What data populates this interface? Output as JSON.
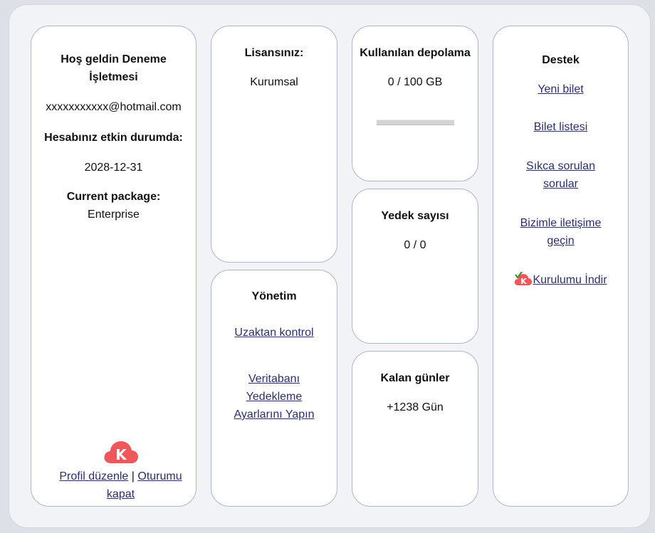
{
  "profile": {
    "welcome": "Hoş geldin Deneme İşletmesi",
    "email": "xxxxxxxxxxx@hotmail.com",
    "active_label": "Hesabınız etkin durumda:",
    "expiry_date": "2028-12-31",
    "package_label": "Current package:",
    "package_value": "Enterprise",
    "edit_profile": "Profil düzenle",
    "separator": "|",
    "logout": "Oturumu kapat",
    "logo_letter": "K"
  },
  "license": {
    "title": "Lisansınız:",
    "value": "Kurumsal"
  },
  "management": {
    "title": "Yönetim",
    "remote_control": "Uzaktan kontrol",
    "db_backup": "Veritabanı Yedekleme Ayarlarını Yapın"
  },
  "storage": {
    "title": "Kullanılan depolama",
    "value": "0 / 100 GB",
    "used_fraction": 0
  },
  "backups": {
    "title": "Yedek sayısı",
    "value": "0 / 0"
  },
  "remaining": {
    "title": "Kalan günler",
    "value": "+1238 Gün"
  },
  "support": {
    "title": "Destek",
    "new_ticket": "Yeni bilet",
    "ticket_list": "Bilet listesi",
    "faq": "Sıkca sorulan sorular",
    "contact": "Bizimle iletişime geçin",
    "download": "Kurulumu İndir",
    "logo_letter": "K"
  },
  "colors": {
    "brand_red": "#f0575b",
    "link": "#2b2f6b",
    "card_border": "#aeb6cc",
    "check_green": "#2e9a3a"
  }
}
